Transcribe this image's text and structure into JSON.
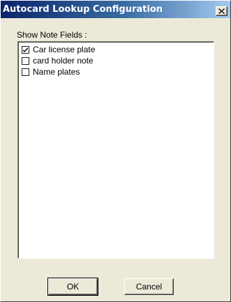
{
  "window": {
    "title": "Autocard Lookup Configuration",
    "close_glyph": "×"
  },
  "group": {
    "label": "Show Note Fields :"
  },
  "list": {
    "items": [
      {
        "label": "Car license plate",
        "checked": true
      },
      {
        "label": "card holder note",
        "checked": false
      },
      {
        "label": "Name plates",
        "checked": false
      }
    ]
  },
  "buttons": {
    "ok_label": "OK",
    "cancel_label": "Cancel"
  },
  "icons": {
    "close": "close-icon",
    "checkmark": "checkmark-icon"
  },
  "colors": {
    "title_start": "#0a246a",
    "title_end": "#a6caf0",
    "dialog_bg": "#ece9d8"
  }
}
